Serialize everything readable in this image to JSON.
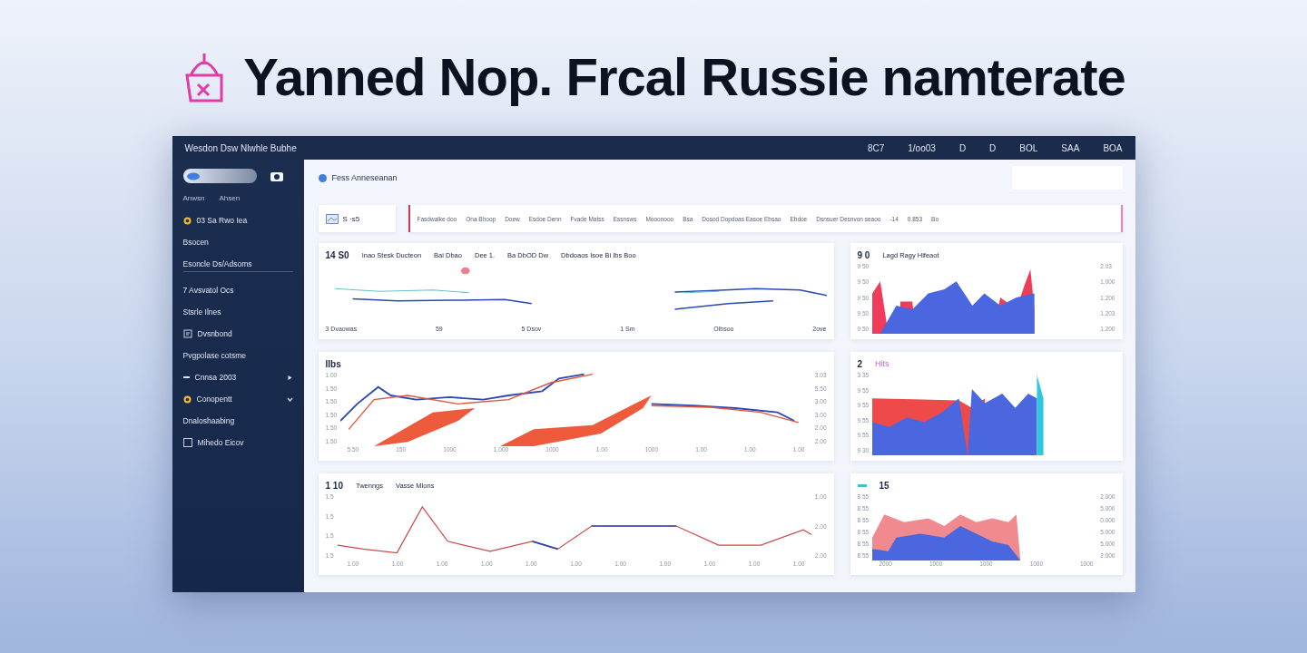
{
  "headline": "Yanned Nop. Frcal Russie namterate",
  "window": {
    "title": "Wesdon Dsw Nlwhle Bubhe",
    "top_items": [
      "8C7",
      "1/oo03",
      "D",
      "D",
      "BOL",
      "SAA",
      "BOA"
    ]
  },
  "sidebar": {
    "captions": [
      "Anwsn",
      "Ahsen"
    ],
    "items": [
      {
        "kind": "dot",
        "label": "03 Sa Rwo Iea"
      },
      {
        "kind": "plain",
        "label": "Bsocen"
      },
      {
        "kind": "underline",
        "label": "Esoncle Ds/Adsoms"
      },
      {
        "kind": "plain",
        "label": "7 Avsvatol Ocs"
      },
      {
        "kind": "plain",
        "label": "Stsrle Ilnes"
      },
      {
        "kind": "doc",
        "label": "Dvsnbond"
      },
      {
        "kind": "plain",
        "label": "Pvgpolase cotsme"
      },
      {
        "kind": "group",
        "label": "Cnnsa 2003",
        "expanded": false
      },
      {
        "kind": "group-dot",
        "label": "Conopentt",
        "expanded": true
      },
      {
        "kind": "plain",
        "label": "Dnaloshaabing"
      },
      {
        "kind": "check",
        "label": "Mihedo Eicov",
        "checked": false
      }
    ]
  },
  "header": {
    "title": "Fess Anneseanan"
  },
  "filter": {
    "label": "S ·s5",
    "items": [
      "Fasdwalke doo",
      "Ona Bhoop",
      "Doew",
      "Esdoe Denn",
      "Fvade Matss",
      "Essnsws",
      "Mooonooo",
      "Bsa",
      "Dosod Dopdoas Easoe Ebsao",
      "Ebdoe",
      "Dsnsuer Desnvon seaoo",
      "-14",
      "0.853",
      "Bo"
    ]
  },
  "cards": [
    {
      "kind": "sparklines",
      "title": "14 S0",
      "labels": [
        "Inao Stesk Ducteon",
        "Bai Dbao",
        "Dee 1.",
        "Ba DbOD Dw",
        "Dbdoaos Isoe Bi Ibs Boo"
      ],
      "footer": [
        "3 Dvaowas",
        "59",
        "5 Dsov",
        "1 Sm",
        "Olbsoo",
        "2ove"
      ]
    },
    {
      "kind": "area",
      "title": "9 0",
      "labels": [
        "Lagd Ragy Hifeaot"
      ],
      "left_ticks": [
        "9 50",
        "9 50",
        "9 50",
        "9 50",
        "9 50"
      ],
      "right_ticks": [
        "2.03",
        "1.000",
        "1.200",
        "1.203",
        "1.200"
      ]
    },
    {
      "kind": "bands",
      "title": "Ilbs",
      "left_ticks": [
        "1.00",
        "1.50",
        "1.50",
        "1.50",
        "1.50",
        "1.50"
      ],
      "right_ticks": [
        "3.03",
        "5.50",
        "3.00",
        "3.00",
        "2.00",
        "2.00"
      ],
      "x_ticks": [
        "5.50",
        "150",
        "1000",
        "1.000",
        "1000",
        "1.00",
        "1000",
        "1.00",
        "1.00",
        "1.00"
      ]
    },
    {
      "kind": "area-cyan",
      "title": "2",
      "accent": "Hits",
      "left_ticks": [
        "3 35",
        "9 55",
        "9 55",
        "9 55",
        "9 55",
        "9 30"
      ]
    },
    {
      "kind": "lines",
      "title": "1 10",
      "labels": [
        "Twenngs",
        "Vasse Mlons"
      ],
      "left_ticks": [
        "1.5",
        "1.5",
        "1.5",
        "1.5"
      ],
      "right_ticks": [
        "1.00",
        "2.00",
        "2.00"
      ],
      "x_ticks": [
        "1.00",
        "1.00",
        "1.00",
        "1.00",
        "1.00",
        "1.00",
        "1.00",
        "1.00",
        "1.00",
        "1.00",
        "1.00"
      ]
    },
    {
      "kind": "area-soft",
      "title": "15",
      "left_ticks": [
        "8 55",
        "8 55",
        "8 55",
        "8 55",
        "8 55",
        "8 55"
      ],
      "right_ticks": [
        "2.000",
        "5.000",
        "0.000",
        "5.000",
        "5.000",
        "2.000"
      ],
      "x_ticks": [
        "2000",
        "1000",
        "1000",
        "1000",
        "1000"
      ]
    }
  ]
}
